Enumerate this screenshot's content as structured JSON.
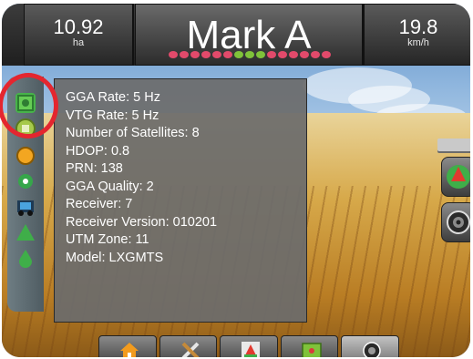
{
  "header": {
    "area": {
      "value": "10.92",
      "unit": "ha"
    },
    "title": "Mark A",
    "speed": {
      "value": "19.8",
      "unit": "km/h"
    }
  },
  "lightbar_colors": [
    "#e24a6b",
    "#e24a6b",
    "#e24a6b",
    "#e24a6b",
    "#e24a6b",
    "#e24a6b",
    "#7fc23a",
    "#7fc23a",
    "#7fc23a",
    "#e24a6b",
    "#e24a6b",
    "#e24a6b",
    "#e24a6b",
    "#e24a6b",
    "#e24a6b"
  ],
  "gps_info": {
    "lines": [
      "GGA Rate: 5 Hz",
      "VTG Rate: 5 Hz",
      "Number of Satellites: 8",
      "HDOP: 0.8",
      "PRN: 138",
      "GGA Quality: 2",
      "Receiver: 7",
      "Receiver Version: 010201",
      "UTM Zone: 11",
      "Model: LXGMTS"
    ]
  },
  "sidebar_icons": [
    "gps-status-icon",
    "satellite-icon",
    "steering-icon",
    "boom-icon",
    "tractor-icon",
    "triangle-guidance-icon",
    "liquid-drop-icon"
  ],
  "right_buttons": [
    "perspective-icon",
    "camera-icon"
  ],
  "bottom_tabs": [
    "home-icon",
    "tools-icon",
    "guidance-icon",
    "map-icon",
    "camera-icon"
  ],
  "colors": {
    "highlight_ring": "#e4262f",
    "accent_green": "#7fc23a"
  }
}
